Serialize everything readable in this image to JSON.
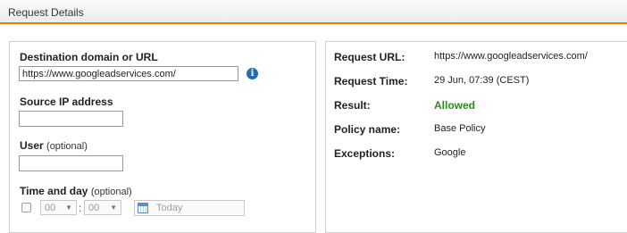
{
  "header": {
    "title": "Request Details"
  },
  "form": {
    "destination": {
      "label": "Destination domain or URL",
      "value": "https://www.googleadservices.com/"
    },
    "info_icon_glyph": "i",
    "source_ip": {
      "label": "Source IP address",
      "value": ""
    },
    "user": {
      "label": "User",
      "optional": "(optional)",
      "value": ""
    },
    "time_day": {
      "label": "Time and day",
      "optional": "(optional)",
      "enabled": false,
      "hour": "00",
      "colon": ":",
      "minute": "00",
      "arrow": "▼",
      "date_placeholder": "Today"
    }
  },
  "result_panel": {
    "rows": [
      {
        "label": "Request URL:",
        "value": "https://www.googleadservices.com/"
      },
      {
        "label": "Request Time:",
        "value": "29 Jun, 07:39 (CEST)"
      },
      {
        "label": "Result:",
        "value": "Allowed"
      },
      {
        "label": "Policy name:",
        "value": "Base Policy"
      },
      {
        "label": "Exceptions:",
        "value": "Google"
      }
    ]
  },
  "colors": {
    "accent": "#f07d00",
    "allowed": "#2e8b1f",
    "info": "#1f6fb5"
  }
}
